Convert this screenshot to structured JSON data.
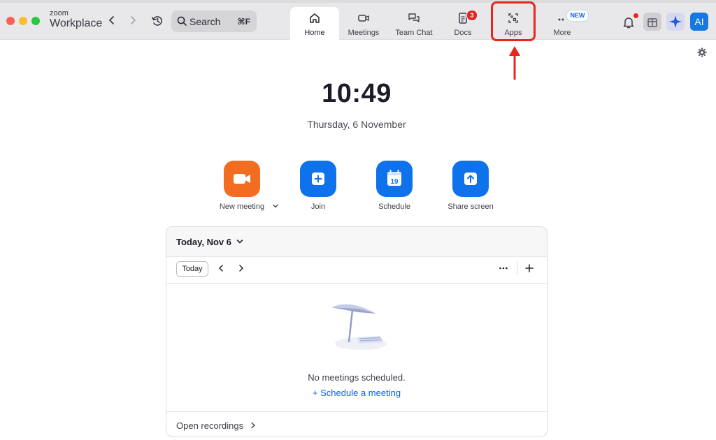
{
  "app": {
    "brand_top": "zoom",
    "brand_bottom": "Workplace"
  },
  "search": {
    "label": "Search",
    "shortcut": "⌘F"
  },
  "tabs": [
    {
      "label": "Home",
      "icon": "home-icon",
      "active": true
    },
    {
      "label": "Meetings",
      "icon": "video-camera-icon"
    },
    {
      "label": "Team Chat",
      "icon": "chat-bubbles-icon"
    },
    {
      "label": "Docs",
      "icon": "document-icon",
      "badge": "3"
    },
    {
      "label": "Apps",
      "icon": "apps-grid-icon",
      "highlighted": true
    },
    {
      "label": "More",
      "icon": "more-dots-icon",
      "badge_text": "NEW"
    }
  ],
  "header_right": {
    "avatar_initials": "AI"
  },
  "home": {
    "time": "10:49",
    "date": "Thursday, 6 November",
    "actions": [
      {
        "label": "New meeting",
        "icon": "video-camera-icon",
        "color": "#f26d21"
      },
      {
        "label": "Join",
        "icon": "plus-icon",
        "color": "#0e72ed"
      },
      {
        "label": "Schedule",
        "icon": "calendar-icon",
        "color": "#0e72ed",
        "calendar_day": "19"
      },
      {
        "label": "Share screen",
        "icon": "share-arrow-icon",
        "color": "#0e72ed"
      }
    ]
  },
  "calendar_card": {
    "title": "Today, Nov 6",
    "today_button": "Today",
    "empty_text": "No meetings scheduled.",
    "schedule_link": "+ Schedule a meeting",
    "footer_link": "Open recordings"
  },
  "colors": {
    "accent": "#0e72ed",
    "highlight": "#e8261c",
    "orange": "#f26d21"
  }
}
